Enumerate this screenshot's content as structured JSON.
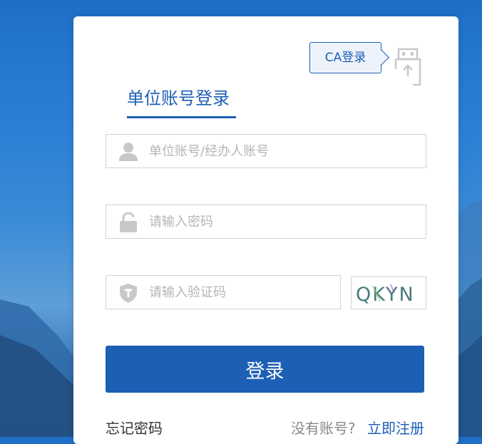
{
  "ca_login": {
    "label": "CA登录",
    "icon": "usb-key-icon"
  },
  "tab": {
    "title": "单位账号登录"
  },
  "account_field": {
    "placeholder": "单位账号/经办人账号",
    "icon": "user-icon"
  },
  "password_field": {
    "placeholder": "请输入密码",
    "icon": "lock-icon"
  },
  "captcha_field": {
    "placeholder": "请输入验证码",
    "icon": "shield-icon"
  },
  "captcha_image": {
    "text": "QKYN"
  },
  "login_button": {
    "label": "登录"
  },
  "footer": {
    "forgot": "忘记密码",
    "no_account": "没有账号?",
    "register": "立即注册"
  },
  "colors": {
    "primary": "#1c5fb5",
    "background_top": "#1f6fc7",
    "placeholder": "#b5b5b5"
  }
}
